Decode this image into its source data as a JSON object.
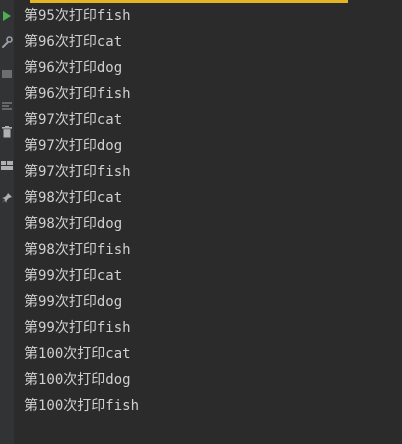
{
  "toolbar": {
    "icons": [
      "run-icon",
      "wrench-icon",
      "stop-icon",
      "sort-icon",
      "trash-icon",
      "layout-icon",
      "pin-icon"
    ]
  },
  "console": {
    "lines": [
      "第95次打印fish",
      "第96次打印cat",
      "第96次打印dog",
      "第96次打印fish",
      "第97次打印cat",
      "第97次打印dog",
      "第97次打印fish",
      "第98次打印cat",
      "第98次打印dog",
      "第98次打印fish",
      "第99次打印cat",
      "第99次打印dog",
      "第99次打印fish",
      "第100次打印cat",
      "第100次打印dog",
      "第100次打印fish"
    ]
  },
  "colors": {
    "background": "#2b2b2b",
    "toolbar": "#313335",
    "text": "#d0d0d0",
    "run": "#4caf50",
    "accent": "#e6b422"
  }
}
